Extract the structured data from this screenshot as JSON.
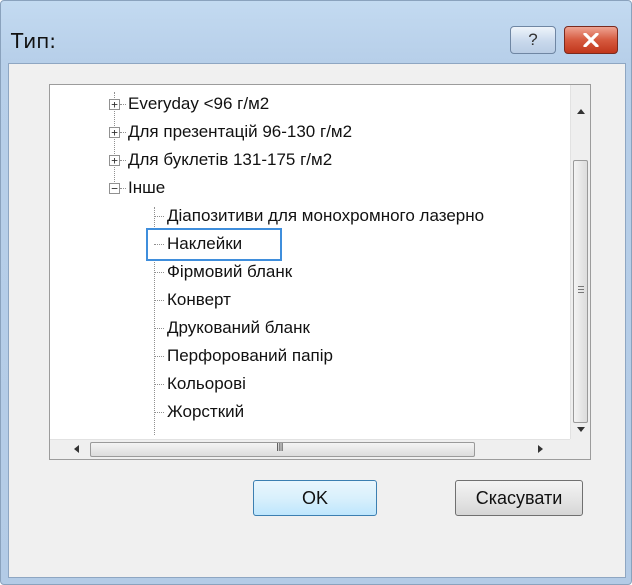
{
  "window": {
    "title": "Тип:"
  },
  "title_buttons": {
    "help_label": "?",
    "close_icon": "close-x-icon"
  },
  "tree": {
    "groups": [
      {
        "label": "Everyday <96 г/м2",
        "expander": "+"
      },
      {
        "label": "Для презентацій 96-130 г/м2",
        "expander": "+"
      },
      {
        "label": "Для буклетів 131-175 г/м2",
        "expander": "+"
      },
      {
        "label": "Інше",
        "expander": "−"
      }
    ],
    "children": [
      "Діапозитиви для монохромного лазерно",
      "Наклейки",
      "Фірмовий бланк",
      "Конверт",
      "Друкований бланк",
      "Перфорований папір",
      "Кольорові",
      "Жорсткий"
    ],
    "selected_child": "Наклейки"
  },
  "scrollbars": {
    "h_grip": "III"
  },
  "buttons": {
    "ok": "OK",
    "cancel": "Скасувати"
  },
  "colors": {
    "selection_border": "#3f8edc",
    "close_button": "#c9452a"
  }
}
